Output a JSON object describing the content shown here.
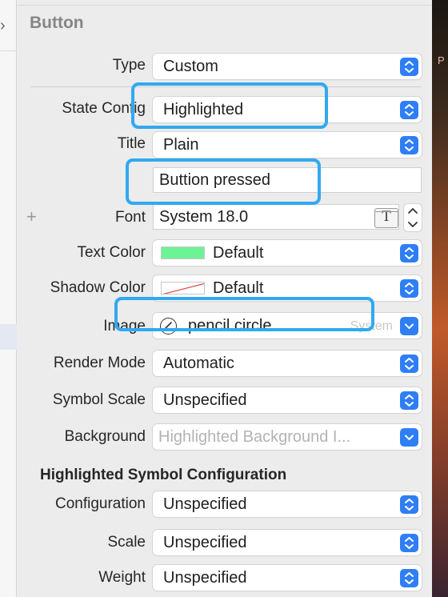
{
  "section_title": "Button",
  "rows": {
    "type": {
      "label": "Type",
      "value": "Custom"
    },
    "state_config": {
      "label": "State Config",
      "value": "Highlighted"
    },
    "title": {
      "label": "Title",
      "value": "Plain"
    },
    "title_text": {
      "value": "Buttion pressed"
    },
    "font": {
      "label": "Font",
      "value": "System 18.0"
    },
    "text_color": {
      "label": "Text Color",
      "value": "Default",
      "swatch": "#6cf396"
    },
    "shadow_color": {
      "label": "Shadow Color",
      "value": "Default"
    },
    "image": {
      "label": "Image",
      "value": "pencil.circle",
      "hint": "System"
    },
    "render_mode": {
      "label": "Render Mode",
      "value": "Automatic"
    },
    "symbol_scale": {
      "label": "Symbol Scale",
      "value": "Unspecified"
    },
    "background": {
      "label": "Background",
      "placeholder": "Highlighted Background I..."
    }
  },
  "symbol_section": {
    "title": "Highlighted Symbol Configuration",
    "configuration": {
      "label": "Configuration",
      "value": "Unspecified"
    },
    "scale": {
      "label": "Scale",
      "value": "Unspecified"
    },
    "weight": {
      "label": "Weight",
      "value": "Unspecified"
    }
  },
  "desktop_text": "P",
  "colors": {
    "accent": "#2f7ef5",
    "highlight_box": "#31a9f0"
  }
}
